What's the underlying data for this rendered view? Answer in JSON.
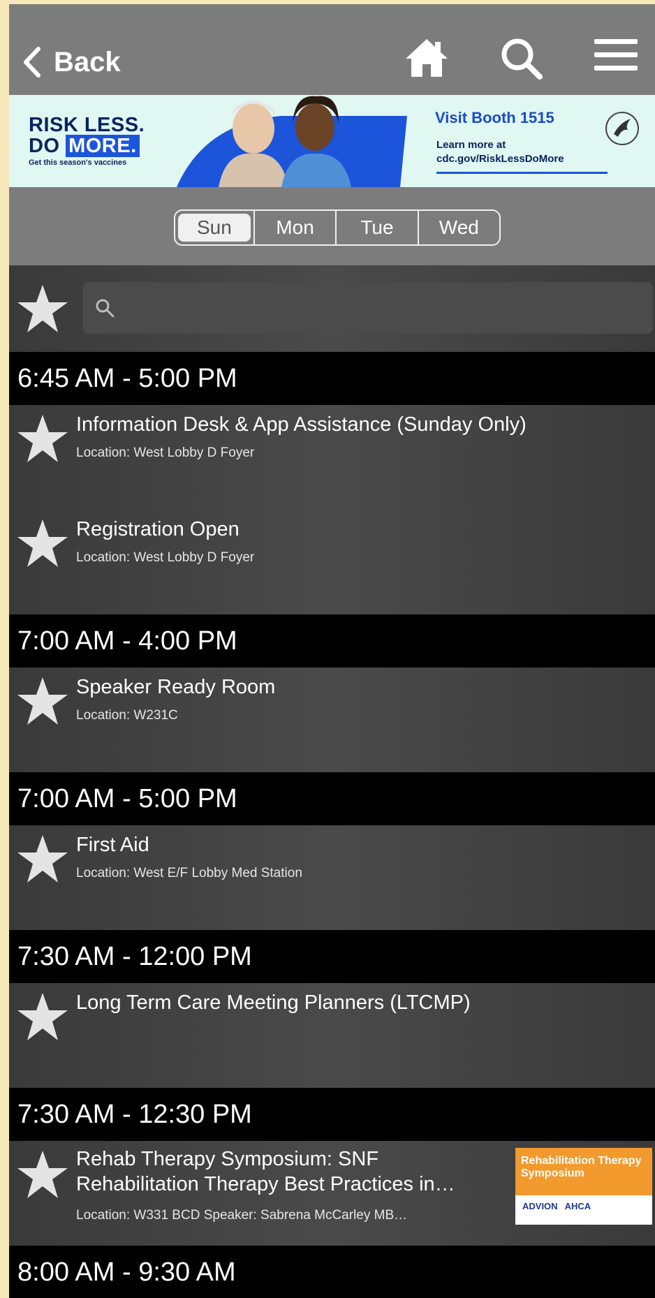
{
  "header": {
    "back_label": "Back"
  },
  "banner": {
    "headline_1": "RISK LESS.",
    "headline_2a": "DO",
    "headline_2b": "MORE.",
    "tagline": "Get this season's vaccines",
    "booth": "Visit Booth 1515",
    "learn_1": "Learn more at",
    "learn_2": "cdc.gov/RiskLessDoMore"
  },
  "days": [
    "Sun",
    "Mon",
    "Tue",
    "Wed"
  ],
  "selected_day": "Sun",
  "schedule": [
    {
      "time": "6:45 AM - 5:00 PM",
      "items": [
        {
          "title": "Information Desk & App Assistance (Sunday Only)",
          "location": "Location: West Lobby D Foyer"
        },
        {
          "title": "Registration Open",
          "location": "Location: West Lobby D Foyer"
        }
      ]
    },
    {
      "time": "7:00 AM - 4:00 PM",
      "items": [
        {
          "title": "Speaker Ready Room",
          "location": "Location: W231C"
        }
      ]
    },
    {
      "time": "7:00 AM - 5:00 PM",
      "items": [
        {
          "title": "First Aid",
          "location": "Location: West E/F Lobby Med Station"
        }
      ]
    },
    {
      "time": "7:30 AM - 12:00 PM",
      "items": [
        {
          "title": "Long Term Care Meeting Planners (LTCMP)",
          "location": ""
        }
      ]
    },
    {
      "time": "7:30 AM - 12:30 PM",
      "items": [
        {
          "title_1": "Rehab Therapy Symposium: SNF",
          "title_2": "Rehabilitation Therapy Best Practices in…",
          "location": "Location: W331 BCD Speaker: Sabrena McCarley MB…",
          "thumb_title": "Rehabilitation Therapy Symposium",
          "thumb_logo_1": "ADVION",
          "thumb_logo_2": "AHCA"
        }
      ]
    },
    {
      "time": "8:00 AM - 9:30 AM",
      "items": []
    }
  ]
}
